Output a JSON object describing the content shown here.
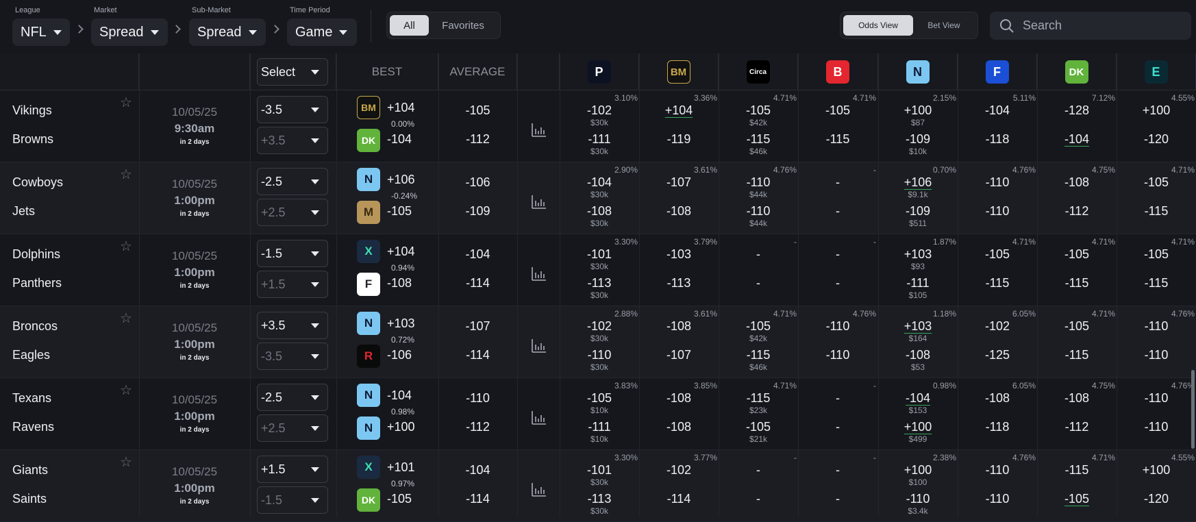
{
  "filters": [
    {
      "label": "League",
      "value": "NFL"
    },
    {
      "label": "Market",
      "value": "Spread"
    },
    {
      "label": "Sub-Market",
      "value": "Spread"
    },
    {
      "label": "Time Period",
      "value": "Game"
    }
  ],
  "scope_tabs": [
    "All",
    "Favorites"
  ],
  "view_tabs": [
    "Odds View",
    "Bet View"
  ],
  "search": {
    "placeholder": "Search"
  },
  "table_header": {
    "select_label": "Select",
    "best": "BEST",
    "average": "AVERAGE"
  },
  "books": [
    {
      "name": "prizepicks",
      "glyph": "P",
      "bg": "#0d1222",
      "fg": "#ffffff"
    },
    {
      "name": "betmgm",
      "glyph": "BM",
      "bg": "#111111",
      "fg": "#c9a84a"
    },
    {
      "name": "circa",
      "glyph": "Circa",
      "bg": "#000000",
      "fg": "#ffffff"
    },
    {
      "name": "betrivers",
      "glyph": "B",
      "bg": "#e3262f",
      "fg": "#ffffff"
    },
    {
      "name": "novig",
      "glyph": "N",
      "bg": "#7cc7f2",
      "fg": "#0e1a33"
    },
    {
      "name": "fanduel",
      "glyph": "F",
      "bg": "#1a4fd6",
      "fg": "#ffffff"
    },
    {
      "name": "draftkings",
      "glyph": "DK",
      "bg": "#61b33b",
      "fg": "#ffffff"
    },
    {
      "name": "espnbet",
      "glyph": "E",
      "bg": "#0a2a33",
      "fg": "#3ee0d0"
    }
  ],
  "games": [
    {
      "team1": "Vikings",
      "team2": "Browns",
      "date": "10/05/25",
      "time": "9:30am",
      "relative": "in 2 days",
      "spread1": "-3.5",
      "spread2": "+3.5",
      "best1_book": "betmgm",
      "best1": "+104",
      "best_pct": "0.00%",
      "best2_book": "draftkings",
      "best2": "-104",
      "avg1": "-105",
      "avg2": "-112",
      "odds": [
        {
          "pct": "3.10%",
          "o1": "-102",
          "l1": "$30k",
          "o2": "-111",
          "l2": "$30k"
        },
        {
          "pct": "3.36%",
          "o1": "+104",
          "l1": "",
          "o2": "-119",
          "l2": "",
          "best1": true
        },
        {
          "pct": "4.71%",
          "o1": "-105",
          "l1": "$42k",
          "o2": "-115",
          "l2": "$46k"
        },
        {
          "pct": "4.71%",
          "o1": "-105",
          "l1": "",
          "o2": "-115",
          "l2": ""
        },
        {
          "pct": "2.15%",
          "o1": "+100",
          "l1": "$87",
          "o2": "-109",
          "l2": "$10k"
        },
        {
          "pct": "5.11%",
          "o1": "-104",
          "l1": "",
          "o2": "-118",
          "l2": ""
        },
        {
          "pct": "7.12%",
          "o1": "-128",
          "l1": "",
          "o2": "-104",
          "l2": "",
          "best2": true
        },
        {
          "pct": "4.55%",
          "o1": "+100",
          "l1": "",
          "o2": "-120",
          "l2": ""
        }
      ]
    },
    {
      "team1": "Cowboys",
      "team2": "Jets",
      "date": "10/05/25",
      "time": "1:00pm",
      "relative": "in 2 days",
      "spread1": "-2.5",
      "spread2": "+2.5",
      "best1_book": "novig",
      "best1": "+106",
      "best_pct": "-0.24%",
      "best2_book": "mgmlion",
      "best2": "-105",
      "avg1": "-106",
      "avg2": "-109",
      "odds": [
        {
          "pct": "2.90%",
          "o1": "-104",
          "l1": "$30k",
          "o2": "-108",
          "l2": "$30k"
        },
        {
          "pct": "3.61%",
          "o1": "-107",
          "l1": "",
          "o2": "-108",
          "l2": ""
        },
        {
          "pct": "4.76%",
          "o1": "-110",
          "l1": "$44k",
          "o2": "-110",
          "l2": "$44k"
        },
        {
          "pct": "-",
          "o1": "-",
          "l1": "",
          "o2": "-",
          "l2": ""
        },
        {
          "pct": "0.70%",
          "o1": "+106",
          "l1": "$9.1k",
          "o2": "-109",
          "l2": "$511",
          "best1": true
        },
        {
          "pct": "4.76%",
          "o1": "-110",
          "l1": "",
          "o2": "-110",
          "l2": ""
        },
        {
          "pct": "4.75%",
          "o1": "-108",
          "l1": "",
          "o2": "-112",
          "l2": ""
        },
        {
          "pct": "4.71%",
          "o1": "-105",
          "l1": "",
          "o2": "-115",
          "l2": ""
        }
      ]
    },
    {
      "team1": "Dolphins",
      "team2": "Panthers",
      "date": "10/05/25",
      "time": "1:00pm",
      "relative": "in 2 days",
      "spread1": "-1.5",
      "spread2": "+1.5",
      "best1_book": "xbook",
      "best1": "+104",
      "best_pct": "0.94%",
      "best2_book": "whitebook",
      "best2": "-108",
      "avg1": "-104",
      "avg2": "-114",
      "odds": [
        {
          "pct": "3.30%",
          "o1": "-101",
          "l1": "$30k",
          "o2": "-113",
          "l2": "$30k"
        },
        {
          "pct": "3.79%",
          "o1": "-103",
          "l1": "",
          "o2": "-113",
          "l2": ""
        },
        {
          "pct": "-",
          "o1": "-",
          "l1": "",
          "o2": "-",
          "l2": ""
        },
        {
          "pct": "-",
          "o1": "-",
          "l1": "",
          "o2": "-",
          "l2": ""
        },
        {
          "pct": "1.87%",
          "o1": "+103",
          "l1": "$93",
          "o2": "-111",
          "l2": "$105"
        },
        {
          "pct": "4.71%",
          "o1": "-105",
          "l1": "",
          "o2": "-115",
          "l2": ""
        },
        {
          "pct": "4.71%",
          "o1": "-105",
          "l1": "",
          "o2": "-115",
          "l2": ""
        },
        {
          "pct": "4.71%",
          "o1": "-105",
          "l1": "",
          "o2": "-115",
          "l2": ""
        }
      ]
    },
    {
      "team1": "Broncos",
      "team2": "Eagles",
      "date": "10/05/25",
      "time": "1:00pm",
      "relative": "in 2 days",
      "spread1": "+3.5",
      "spread2": "-3.5",
      "best1_book": "novig",
      "best1": "+103",
      "best_pct": "0.72%",
      "best2_book": "redbook",
      "best2": "-106",
      "avg1": "-107",
      "avg2": "-114",
      "odds": [
        {
          "pct": "2.88%",
          "o1": "-102",
          "l1": "$30k",
          "o2": "-110",
          "l2": "$30k"
        },
        {
          "pct": "3.61%",
          "o1": "-108",
          "l1": "",
          "o2": "-107",
          "l2": ""
        },
        {
          "pct": "4.71%",
          "o1": "-105",
          "l1": "$42k",
          "o2": "-115",
          "l2": "$46k"
        },
        {
          "pct": "4.76%",
          "o1": "-110",
          "l1": "",
          "o2": "-110",
          "l2": ""
        },
        {
          "pct": "1.18%",
          "o1": "+103",
          "l1": "$164",
          "o2": "-108",
          "l2": "$53",
          "best1": true
        },
        {
          "pct": "6.05%",
          "o1": "-102",
          "l1": "",
          "o2": "-125",
          "l2": ""
        },
        {
          "pct": "4.71%",
          "o1": "-105",
          "l1": "",
          "o2": "-115",
          "l2": ""
        },
        {
          "pct": "4.76%",
          "o1": "-110",
          "l1": "",
          "o2": "-110",
          "l2": ""
        }
      ]
    },
    {
      "team1": "Texans",
      "team2": "Ravens",
      "date": "10/05/25",
      "time": "1:00pm",
      "relative": "in 2 days",
      "spread1": "-2.5",
      "spread2": "+2.5",
      "best1_book": "novig",
      "best1": "-104",
      "best_pct": "0.98%",
      "best2_book": "novig",
      "best2": "+100",
      "avg1": "-110",
      "avg2": "-112",
      "odds": [
        {
          "pct": "3.83%",
          "o1": "-105",
          "l1": "$10k",
          "o2": "-111",
          "l2": "$10k"
        },
        {
          "pct": "3.85%",
          "o1": "-108",
          "l1": "",
          "o2": "-108",
          "l2": ""
        },
        {
          "pct": "4.71%",
          "o1": "-115",
          "l1": "$23k",
          "o2": "-105",
          "l2": "$21k"
        },
        {
          "pct": "-",
          "o1": "-",
          "l1": "",
          "o2": "-",
          "l2": ""
        },
        {
          "pct": "0.98%",
          "o1": "-104",
          "l1": "$153",
          "o2": "+100",
          "l2": "$499",
          "best1": true,
          "best2": true
        },
        {
          "pct": "6.05%",
          "o1": "-108",
          "l1": "",
          "o2": "-118",
          "l2": ""
        },
        {
          "pct": "4.75%",
          "o1": "-108",
          "l1": "",
          "o2": "-112",
          "l2": ""
        },
        {
          "pct": "4.76%",
          "o1": "-110",
          "l1": "",
          "o2": "-110",
          "l2": ""
        }
      ]
    },
    {
      "team1": "Giants",
      "team2": "Saints",
      "date": "10/05/25",
      "time": "1:00pm",
      "relative": "in 2 days",
      "spread1": "+1.5",
      "spread2": "-1.5",
      "best1_book": "xbook",
      "best1": "+101",
      "best_pct": "0.97%",
      "best2_book": "draftkings",
      "best2": "-105",
      "avg1": "-104",
      "avg2": "-114",
      "odds": [
        {
          "pct": "3.30%",
          "o1": "-101",
          "l1": "$30k",
          "o2": "-113",
          "l2": "$30k"
        },
        {
          "pct": "3.77%",
          "o1": "-102",
          "l1": "",
          "o2": "-114",
          "l2": ""
        },
        {
          "pct": "-",
          "o1": "-",
          "l1": "",
          "o2": "-",
          "l2": ""
        },
        {
          "pct": "-",
          "o1": "-",
          "l1": "",
          "o2": "-",
          "l2": ""
        },
        {
          "pct": "2.38%",
          "o1": "+100",
          "l1": "$100",
          "o2": "-110",
          "l2": "$3.4k"
        },
        {
          "pct": "4.76%",
          "o1": "-110",
          "l1": "",
          "o2": "-110",
          "l2": ""
        },
        {
          "pct": "4.71%",
          "o1": "-115",
          "l1": "",
          "o2": "-105",
          "l2": "",
          "best2": true
        },
        {
          "pct": "4.55%",
          "o1": "+100",
          "l1": "",
          "o2": "-120",
          "l2": ""
        }
      ]
    }
  ]
}
